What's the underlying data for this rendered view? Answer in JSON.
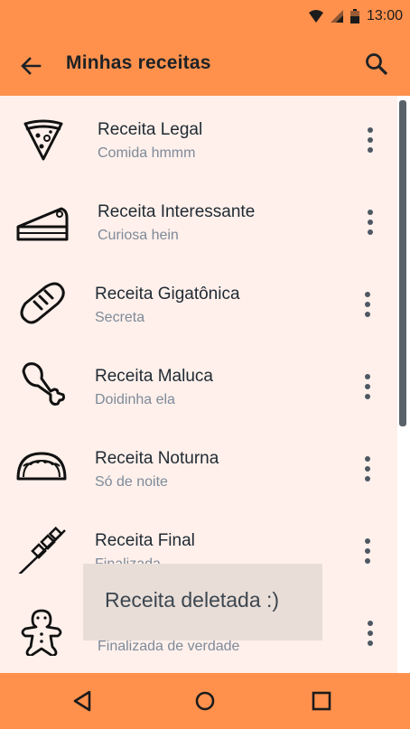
{
  "status": {
    "time": "13:00"
  },
  "appbar": {
    "title": "Minhas receitas",
    "back_icon": "arrow-back-icon",
    "search_icon": "search-icon"
  },
  "recipes": [
    {
      "title": "Receita Legal",
      "subtitle": "Comida hmmm",
      "icon": "pizza-slice-icon"
    },
    {
      "title": "Receita Interessante",
      "subtitle": "Curiosa hein",
      "icon": "cake-slice-icon"
    },
    {
      "title": "Receita Gigatônica",
      "subtitle": "Secreta",
      "icon": "bread-icon"
    },
    {
      "title": "Receita Maluca",
      "subtitle": "Doidinha ela",
      "icon": "chicken-leg-icon"
    },
    {
      "title": "Receita Noturna",
      "subtitle": "Só de noite",
      "icon": "taco-icon"
    },
    {
      "title": "Receita Final",
      "subtitle": "Finalizada",
      "icon": "skewer-icon"
    },
    {
      "title": "",
      "subtitle": "Finalizada de verdade",
      "icon": "gingerbread-man-icon"
    }
  ],
  "toast": {
    "message": "Receita deletada :)"
  },
  "colors": {
    "accent": "#ff914d",
    "list_background": "#fff0eb",
    "toast_background": "#e8ddd7"
  }
}
